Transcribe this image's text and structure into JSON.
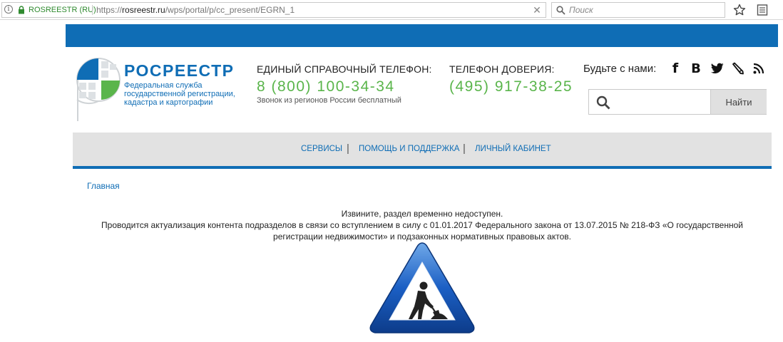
{
  "browser": {
    "site_badge": "ROSREESTR (RU)",
    "url_prefix": "https://",
    "url_domain": "rosreestr.ru",
    "url_path": "/wps/portal/p/cc_present/EGRN_1",
    "clear_glyph": "✕",
    "search_placeholder": "Поиск",
    "icons": [
      "info-icon",
      "lock-icon",
      "search-icon",
      "star-icon",
      "reader-icon"
    ]
  },
  "header": {
    "logo_title": "РОСРЕЕСТР",
    "logo_sub": [
      "Федеральная служба",
      "государственной регистрации,",
      "кадастра и картографии"
    ],
    "hotline": {
      "label": "ЕДИНЫЙ СПРАВОЧНЫЙ ТЕЛЕФОН:",
      "number": "8 (800) 100-34-34",
      "note": "Звонок из регионов России бесплатный"
    },
    "trust": {
      "label": "ТЕЛЕФОН ДОВЕРИЯ:",
      "number": "(495) 917-38-25"
    },
    "social_label": "Будьте с нами:",
    "social": {
      "fb": "f",
      "vk": "B"
    },
    "search_button": "Найти"
  },
  "nav": {
    "items": [
      "СЕРВИСЫ",
      "ПОМОЩЬ И ПОДДЕРЖКА",
      "ЛИЧНЫЙ КАБИНЕТ"
    ],
    "separator": "|"
  },
  "breadcrumb": "Главная",
  "notice": {
    "line1": "Извините, раздел временно недоступен.",
    "line2": "Проводится актуализация контента подразделов в связи со вступлением в силу с 01.01.2017 Федерального закона от 13.07.2015 № 218-ФЗ «О государственной регистрации недвижимости» и подзаконных нормативных правовых актов."
  },
  "colors": {
    "brand_blue": "#0f6db5",
    "accent_green": "#5ab54b",
    "nav_gray": "#e2e2e2"
  }
}
